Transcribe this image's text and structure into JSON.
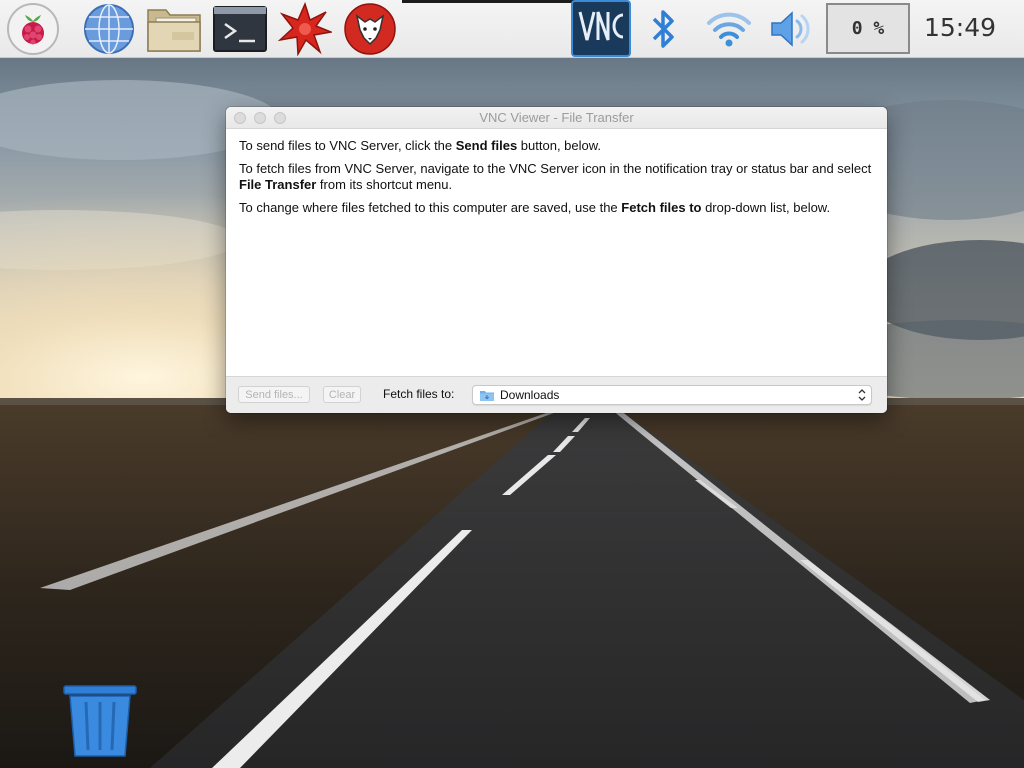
{
  "taskbar": {
    "launchers": [
      {
        "name": "menu",
        "icon": "raspberry-pi-icon"
      },
      {
        "name": "web-browser",
        "icon": "globe-icon"
      },
      {
        "name": "file-manager",
        "icon": "folder-icon"
      },
      {
        "name": "terminal",
        "icon": "terminal-icon"
      },
      {
        "name": "mathematica",
        "icon": "mathematica-icon"
      },
      {
        "name": "wolfram",
        "icon": "wolf-icon"
      }
    ],
    "tray": [
      {
        "name": "vnc",
        "icon": "vnc-icon"
      },
      {
        "name": "bluetooth",
        "icon": "bluetooth-icon"
      },
      {
        "name": "wifi",
        "icon": "wifi-icon"
      },
      {
        "name": "volume",
        "icon": "speaker-icon"
      }
    ],
    "cpu_usage": "0 %",
    "clock": "15:49",
    "colors": {
      "vnc_bg": "#1a3a5c",
      "vnc_border": "#3a8ad6",
      "bluetooth": "#2f7fd6",
      "wifi": "#3d8fd9"
    }
  },
  "window": {
    "title": "VNC Viewer - File Transfer",
    "paragraphs": [
      {
        "before": "To send files to VNC Server, click the ",
        "bold": "Send files",
        "after": " button, below."
      },
      {
        "before": "To fetch files from VNC Server, navigate to the VNC Server icon in the notification tray or status bar and select ",
        "bold": "File Transfer",
        "after": " from its shortcut menu."
      },
      {
        "before": "To change where files fetched to this computer are saved, use the ",
        "bold": "Fetch files to",
        "after": " drop-down list, below."
      }
    ],
    "footer": {
      "send_button": "Send files...",
      "clear_button": "Clear",
      "fetch_label": "Fetch files to:",
      "fetch_value": "Downloads"
    }
  },
  "desktop": {
    "trash_icon": "trash-icon"
  }
}
